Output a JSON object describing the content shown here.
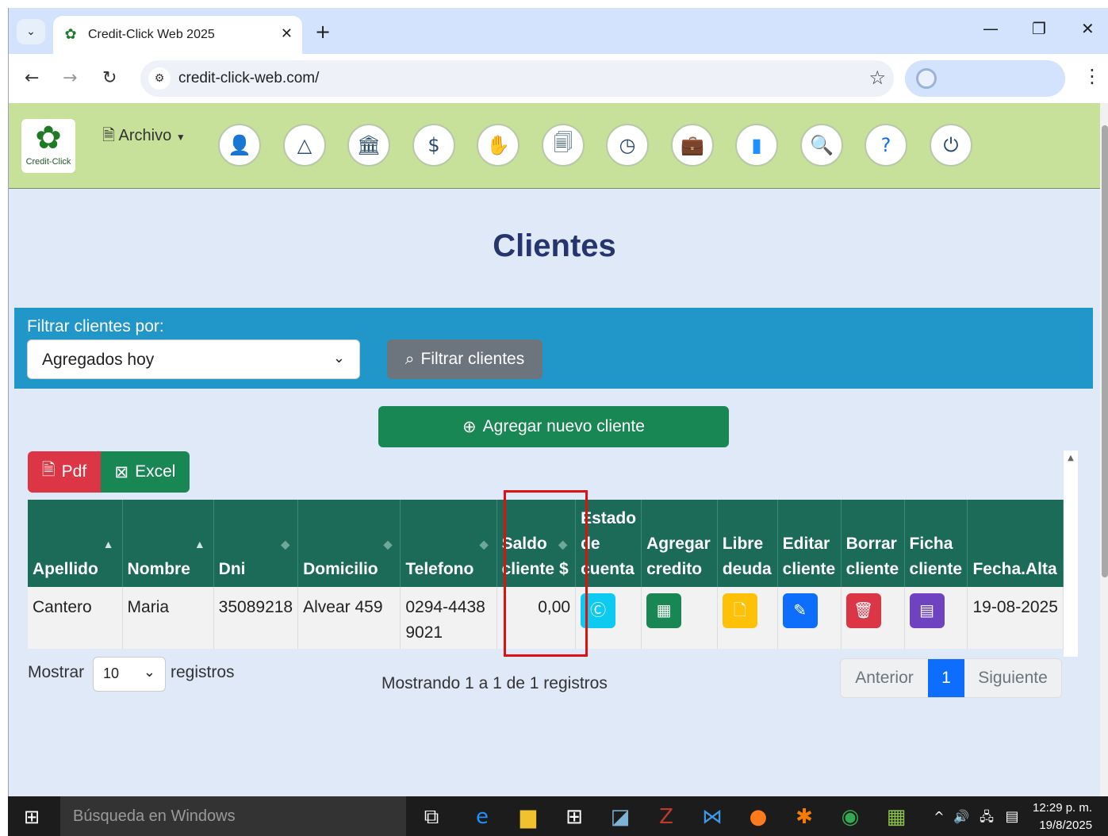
{
  "browser": {
    "tab_title": "Credit-Click Web 2025",
    "url": "credit-click-web.com/"
  },
  "app": {
    "logo_text": "Credit-Click",
    "menu_archivo": "Archivo",
    "header_icons": [
      "user-icon",
      "shapes-icon",
      "bank-icon",
      "money-icon",
      "hand-money-icon",
      "documents-icon",
      "clock-icon",
      "briefcase-icon",
      "chart-icon",
      "search-icon",
      "help-icon",
      "power-icon"
    ]
  },
  "page": {
    "title": "Clientes",
    "filter_label": "Filtrar clientes por:",
    "filter_value": "Agregados hoy",
    "filter_button": "Filtrar clientes",
    "add_button": "Agregar nuevo cliente",
    "pdf_button": "Pdf",
    "excel_button": "Excel"
  },
  "table": {
    "headers": [
      "Apellido",
      "Nombre",
      "Dni",
      "Domicilio",
      "Telefono",
      "Saldo cliente $",
      "Estado de cuenta",
      "Agregar credito",
      "Libre deuda",
      "Editar cliente",
      "Borrar cliente",
      "Ficha cliente",
      "Fecha.Alta"
    ],
    "rows": [
      {
        "apellido": "Cantero",
        "nombre": "Maria",
        "dni": "35089218",
        "domicilio": "Alvear 459",
        "telefono": "0294-44389021",
        "saldo": "0,00",
        "fecha": "19-08-2025"
      }
    ],
    "action_colors": {
      "estado": "#0dcaf0",
      "credito": "#198754",
      "libre": "#ffc107",
      "editar": "#0d6efd",
      "borrar": "#dc3545",
      "ficha": "#6f42c1"
    }
  },
  "footer": {
    "show_label": "Mostrar",
    "show_value": "10",
    "records_label": "registros",
    "info": "Mostrando 1 a 1 de 1 registros",
    "prev": "Anterior",
    "page": "1",
    "next": "Siguiente"
  },
  "taskbar": {
    "search_placeholder": "Búsqueda en Windows",
    "time": "12:29 p. m.",
    "date": "19/8/2025"
  }
}
